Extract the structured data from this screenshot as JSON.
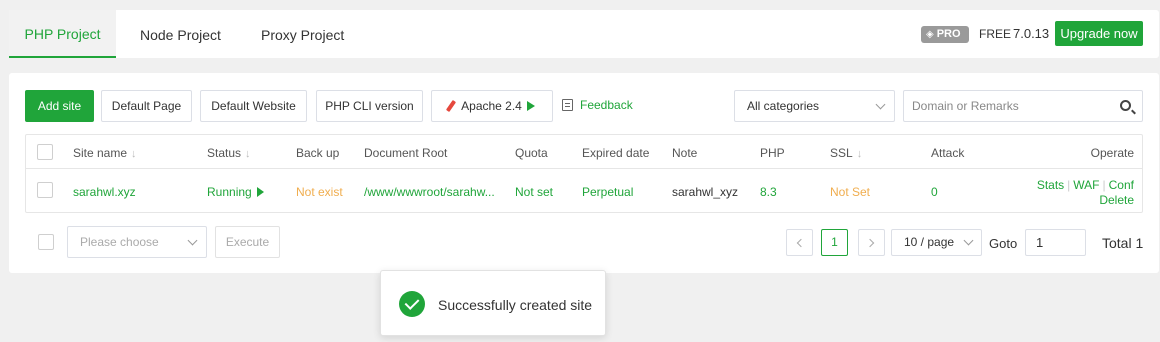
{
  "tabs": {
    "php": "PHP Project",
    "node": "Node Project",
    "proxy": "Proxy Project"
  },
  "header_right": {
    "pro_badge": "PRO",
    "free": "FREE",
    "version": "7.0.13",
    "upgrade": "Upgrade now"
  },
  "toolbar": {
    "add_site": "Add site",
    "default_page": "Default Page",
    "default_website": "Default Website",
    "php_cli": "PHP CLI version",
    "apache": "Apache 2.4",
    "feedback": "Feedback",
    "category": "All categories",
    "search_placeholder": "Domain or Remarks"
  },
  "table": {
    "headers": {
      "site_name": "Site name",
      "status": "Status",
      "backup": "Back up",
      "doc_root": "Document Root",
      "quota": "Quota",
      "expired": "Expired date",
      "note": "Note",
      "php": "PHP",
      "ssl": "SSL",
      "attack": "Attack",
      "operate": "Operate"
    },
    "rows": [
      {
        "site_name": "sarahwl.xyz",
        "status": "Running",
        "backup": "Not exist",
        "doc_root": "/www/wwwroot/sarahw...",
        "quota": "Not set",
        "expired": "Perpetual",
        "note": "sarahwl_xyz",
        "php": "8.3",
        "ssl": "Not Set",
        "attack": "0",
        "ops": [
          "Stats",
          "WAF",
          "Conf",
          "Delete"
        ]
      }
    ]
  },
  "footer": {
    "batch_placeholder": "Please choose",
    "execute": "Execute",
    "current_page": "1",
    "per_page": "10 / page",
    "goto_label": "Goto",
    "goto_value": "1",
    "total": "Total 1"
  },
  "toast": {
    "message": "Successfully created site"
  },
  "colors": {
    "accent": "#20a53a",
    "warning": "#f0ad4e"
  }
}
